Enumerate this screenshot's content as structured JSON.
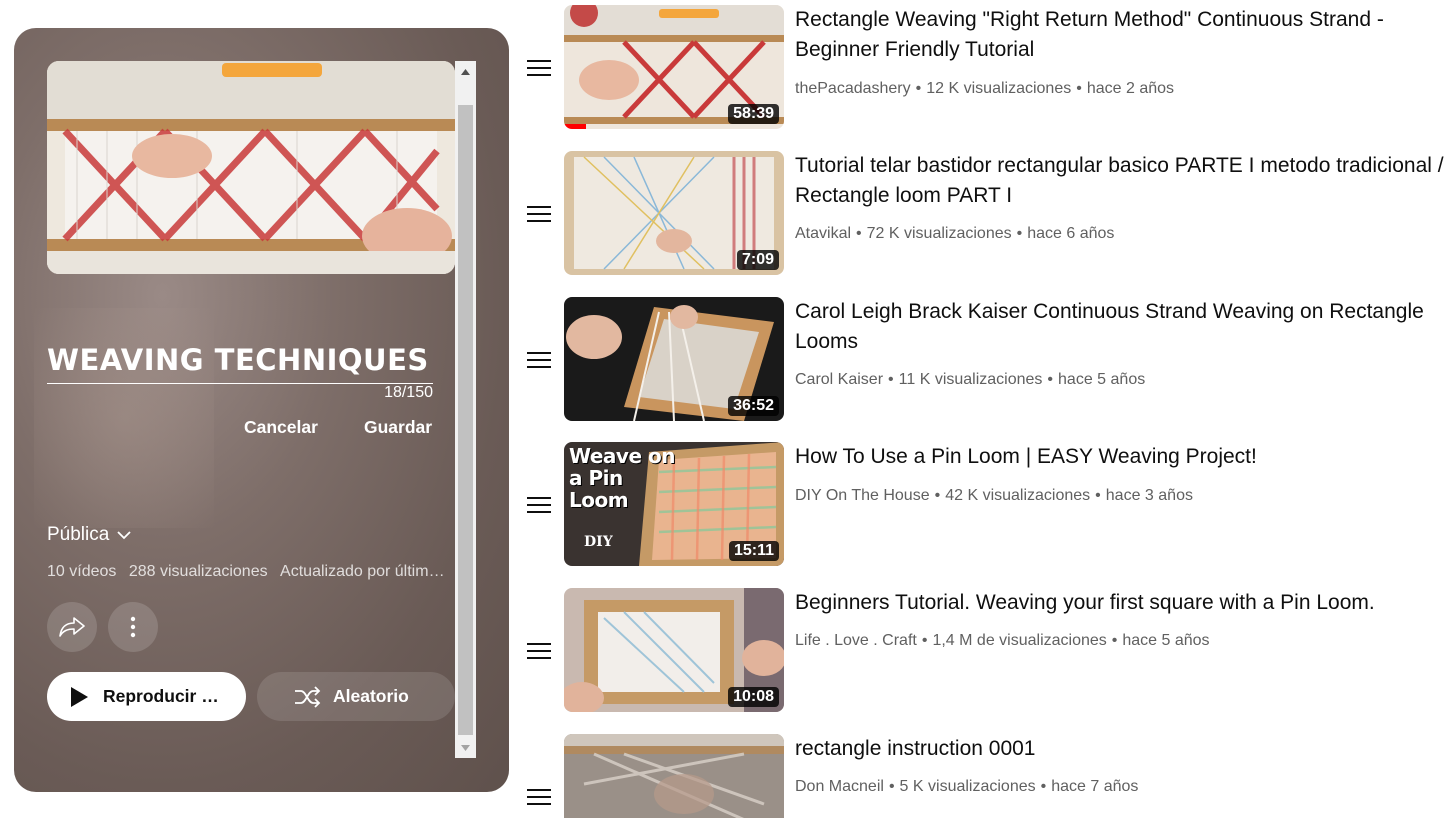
{
  "playlist": {
    "title": "WEAVING TECHNIQUES",
    "char_count": "18/150",
    "cancel_label": "Cancelar",
    "save_label": "Guardar",
    "privacy": "Pública",
    "video_count": "10 vídeos",
    "views": "288 visualizaciones",
    "updated": "Actualizado por última vez",
    "play_all_label": "Reproducir todo",
    "shuffle_label": "Aleatorio"
  },
  "videos": [
    {
      "title": "Rectangle Weaving \"Right Return Method\" Continuous Strand - Beginner Friendly Tutorial",
      "channel": "thePacadashery",
      "views": "12 K visualizaciones",
      "age": "hace 2 años",
      "duration": "58:39",
      "watched_fraction": 0.1
    },
    {
      "title": "Tutorial telar bastidor rectangular basico PARTE I metodo tradicional / Rectangle loom PART I",
      "channel": "Atavikal",
      "views": "72 K visualizaciones",
      "age": "hace 6 años",
      "duration": "7:09"
    },
    {
      "title": "Carol Leigh Brack Kaiser Continuous Strand Weaving on Rectangle Looms",
      "channel": "Carol Kaiser",
      "views": "11 K visualizaciones",
      "age": "hace 5 años",
      "duration": "36:52"
    },
    {
      "title": "How To Use a Pin Loom | EASY Weaving Project!",
      "channel": "DIY On The House",
      "views": "42 K visualizaciones",
      "age": "hace 3 años",
      "duration": "15:11",
      "thumb_text": "Weave on a Pin Loom"
    },
    {
      "title": "Beginners Tutorial. Weaving your first square with a Pin Loom.",
      "channel": "Life . Love . Craft",
      "views": "1,4 M de visualizaciones",
      "age": "hace 5 años",
      "duration": "10:08"
    },
    {
      "title": "rectangle instruction 0001",
      "channel": "Don Macneil",
      "views": "5 K visualizaciones",
      "age": "hace 7 años",
      "duration": ""
    }
  ],
  "separator": "•",
  "icons": [
    "chevron-down-icon",
    "share-icon",
    "more-vert-icon",
    "play-icon",
    "shuffle-icon",
    "drag-handle-icon"
  ]
}
